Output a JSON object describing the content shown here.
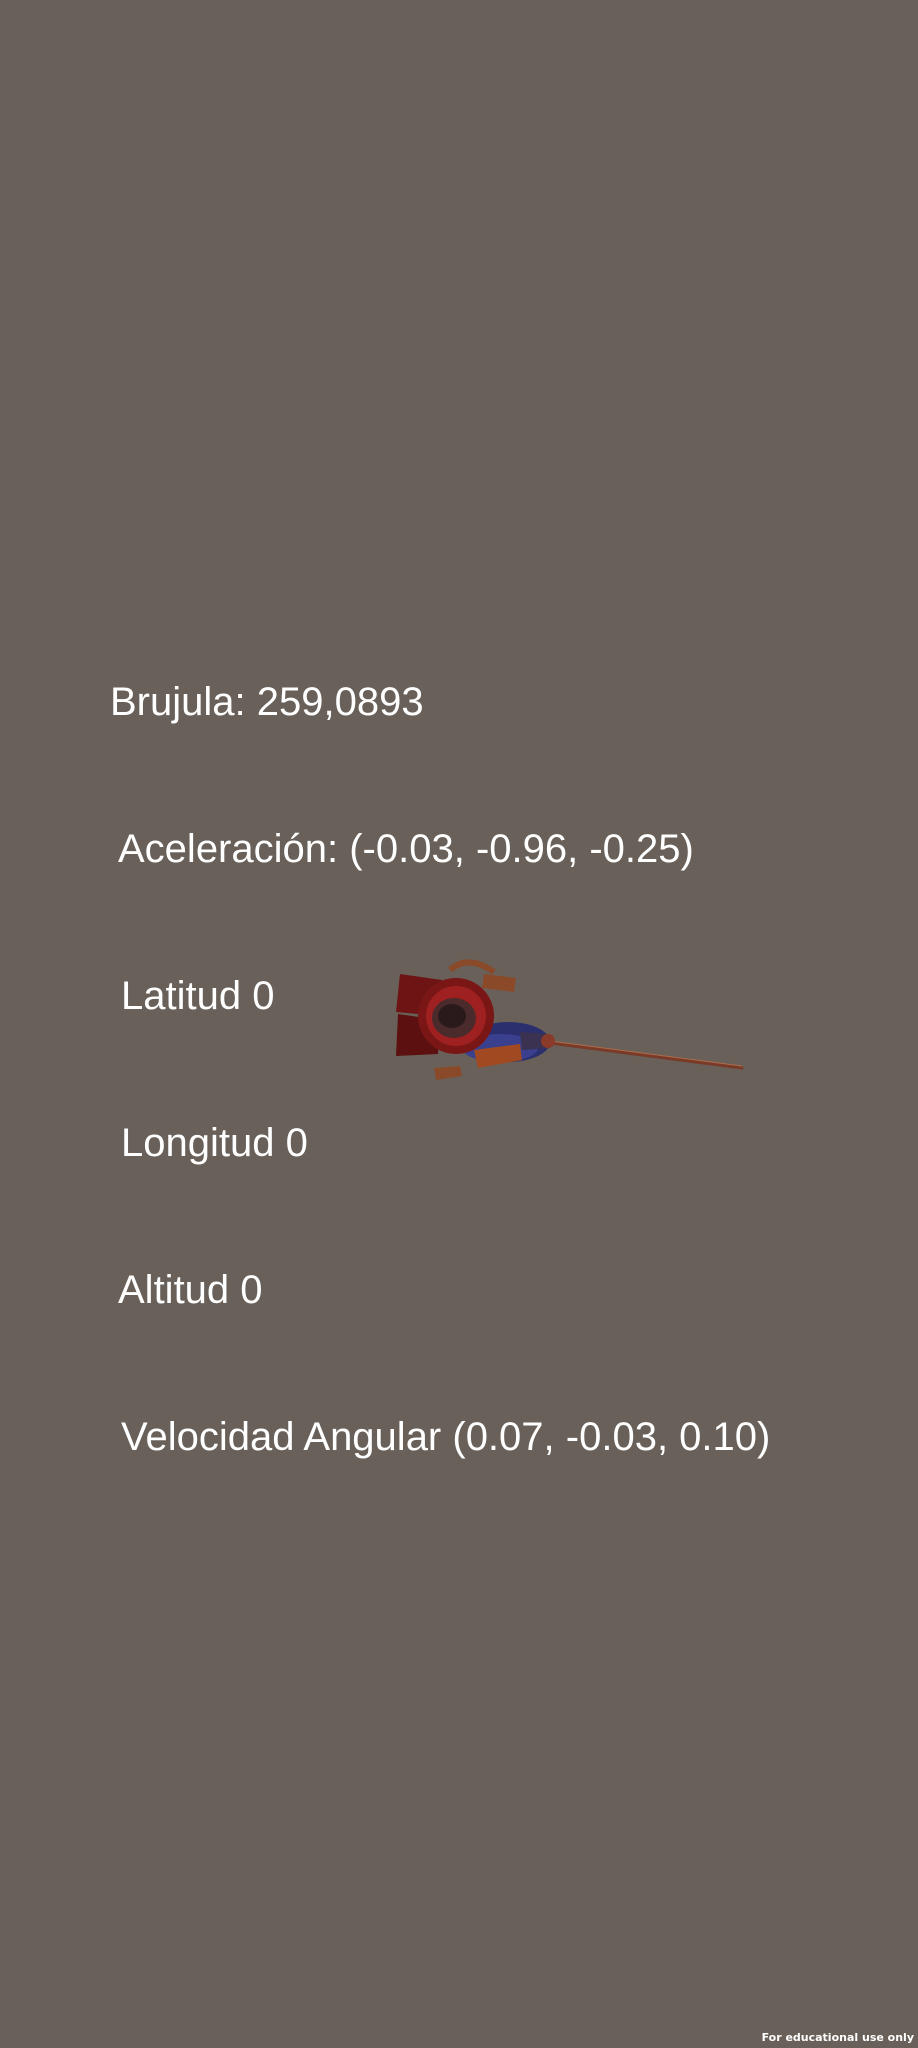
{
  "sensors": {
    "compass": "Brujula: 259,0893",
    "acceleration": "Aceleración: (-0.03, -0.96, -0.25)",
    "latitude": "Latitud 0",
    "longitude": "Longitud 0",
    "altitude": "Altitud 0",
    "angular_velocity": "Velocidad Angular (0.07, -0.03, 0.10)"
  },
  "scene": {
    "background_color": "#686059",
    "character": "samurai-3d-model"
  },
  "watermark": {
    "text": "For educational use only"
  }
}
